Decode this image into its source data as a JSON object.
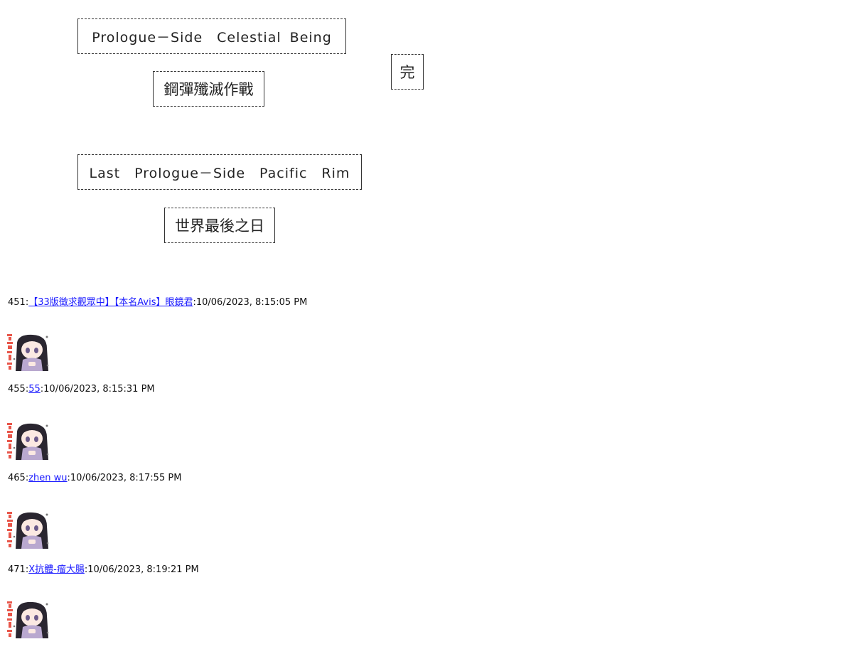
{
  "frames": {
    "prologue_title": "Prologue－Side　Celestial Being",
    "prologue_subtitle": "鋼彈殲滅作戰",
    "end_mark": "完",
    "last_title": "Last　Prologue－Side　Pacific　Rim",
    "last_subtitle": "世界最後之日"
  },
  "posts": [
    {
      "number": "451",
      "sep": ":",
      "author": "【33版徵求觀眾中】【本名Avis】眼鏡君",
      "timestamp": ":10/06/2023, 8:15:05 PM",
      "sticker": "chibi-girl-sticker"
    },
    {
      "number": "455",
      "sep": ":",
      "author": "55",
      "timestamp": ":10/06/2023, 8:15:31 PM",
      "sticker": "chibi-girl-sticker"
    },
    {
      "number": "465",
      "sep": ":",
      "author": "zhen wu",
      "timestamp": ":10/06/2023, 8:17:55 PM",
      "sticker": "chibi-girl-sticker"
    },
    {
      "number": "471",
      "sep": ":",
      "author": "X抗體-瘤大腸",
      "timestamp": ":10/06/2023, 8:19:21 PM",
      "sticker": "chibi-girl-sticker"
    }
  ],
  "colors": {
    "link": "#1a1aff",
    "sticker_side_text": "#e8564a",
    "hair": "#2a2630",
    "dress": "#b9a8cf"
  }
}
